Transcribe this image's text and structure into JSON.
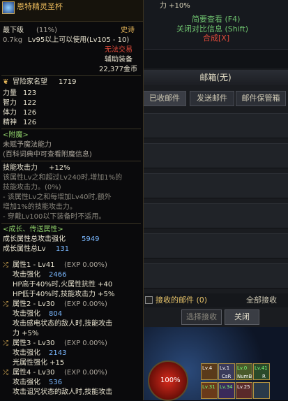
{
  "game_ui": {
    "top_right": {
      "line1": "力 +10%",
      "line2": "简要查看 (F4)",
      "line3": "关闭对比信息 (Shift)",
      "line4": "合成[X]"
    },
    "mailbox": {
      "title": "邮箱(无)",
      "tabs": [
        "已收邮件",
        "发送邮件",
        "邮件保管箱"
      ],
      "received_label": "接收的邮件 (0)",
      "receive_all_label": "全部接收",
      "select_receive_label": "选择接收",
      "close_label": "关闭",
      "percent": "100%",
      "slot_labels": [
        "Lv.4",
        "Lv.1",
        "Lv.0",
        "Lv.41",
        "Lv.31",
        "Lv.34",
        "Lv.25"
      ],
      "slot_sublabels": [
        "CsR",
        "NumB",
        "R"
      ]
    }
  },
  "tooltip": {
    "item_name": "恩特精灵圣杯",
    "grade": "最下级",
    "grade_pct": "(11%)",
    "rarity": "史诗",
    "weight": "0.7kg",
    "level_req": "Lv95以上可以使用(Lv105 - 10)",
    "trade": "无法交易",
    "slot_type": "辅助装备",
    "price": "22,377金币",
    "fame_label": "冒险家名望",
    "fame_value": "1719",
    "stats": [
      {
        "label": "力量",
        "value": "123"
      },
      {
        "label": "智力",
        "value": "122"
      },
      {
        "label": "体力",
        "value": "126"
      },
      {
        "label": "精神",
        "value": "126"
      }
    ],
    "enchant_header": "<附魔>",
    "enchant_line1": "未赋予魔法能力",
    "enchant_line2": "(百科词典中可查看附魔信息)",
    "skill_atk_label": "技能攻击力",
    "skill_atk_value": "+12%",
    "skill_desc": [
      "该属性Lv之和超过Lv240时,增加1%的",
      "技能攻击力。(0%)",
      "- 该属性Lv之和每增加Lv40时,额外",
      "增加1%的技能攻击力。",
      "- 穿戴Lv100以下装备时不适用。"
    ],
    "growth_header": "<成长、传送属性>",
    "growth_atk_label": "成长属性总攻击强化",
    "growth_atk_value": "5949",
    "growth_lv_label": "成长属性总Lv",
    "growth_lv_value": "131",
    "attr1": {
      "title": "属性1 - Lv41",
      "exp": "(EXP 0.00%)",
      "atk_label": "攻击强化",
      "atk_value": "2466",
      "line1": "HP高于40%时,火属性抗性 +40",
      "line2": "HP低于40%时,技能攻击力 +5%"
    },
    "attr2": {
      "title": "属性2 - Lv30",
      "exp": "(EXP 0.00%)",
      "atk_label": "攻击强化",
      "atk_value": "804",
      "line1": "攻击感电状态的敌人时,技能攻击",
      "line2": "力 +5%"
    },
    "attr3": {
      "title": "属性3 - Lv30",
      "exp": "(EXP 0.00%)",
      "atk_label": "攻击强化",
      "atk_value": "2143",
      "line1": "光属性强化 +15"
    },
    "attr4": {
      "title": "属性4 - Lv30",
      "exp": "(EXP 0.00%)",
      "atk_label": "攻击强化",
      "atk_value": "536",
      "line1": "攻击诅咒状态的敌人时,技能攻击"
    }
  }
}
